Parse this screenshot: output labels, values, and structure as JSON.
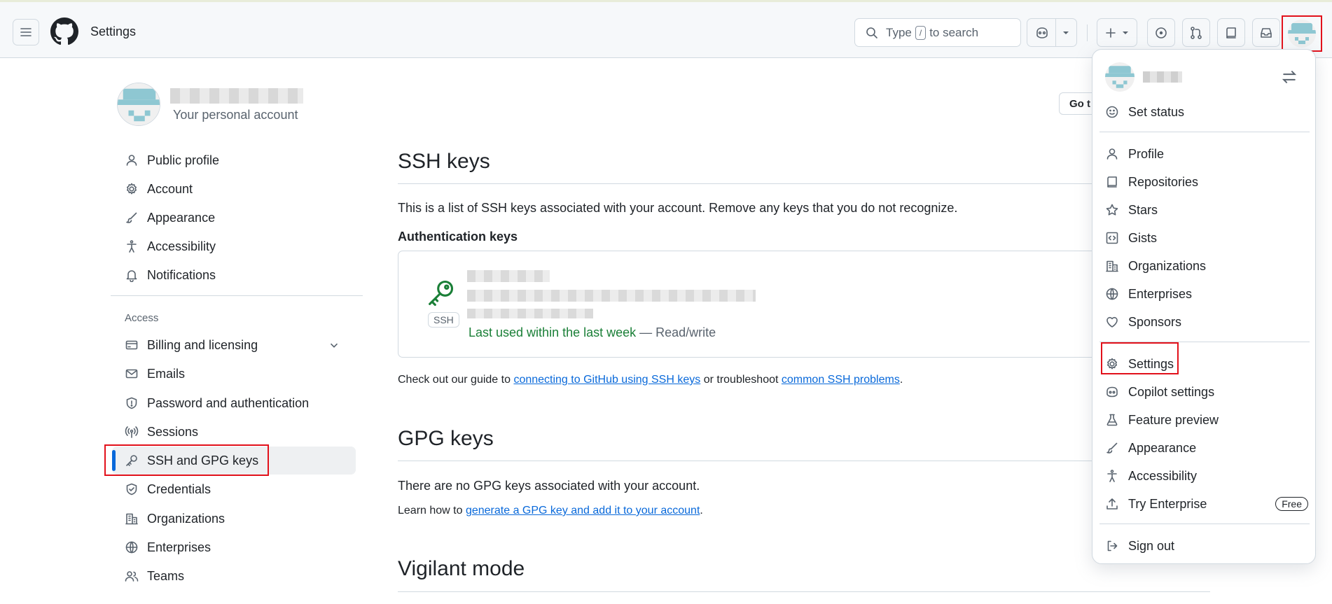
{
  "header": {
    "title": "Settings",
    "search_prefix": "Type",
    "search_key": "/",
    "search_suffix": "to search"
  },
  "profile": {
    "subtitle": "Your personal account"
  },
  "nav": {
    "items_top": [
      {
        "label": "Public profile",
        "icon": "person-icon"
      },
      {
        "label": "Account",
        "icon": "gear-icon"
      },
      {
        "label": "Appearance",
        "icon": "paintbrush-icon"
      },
      {
        "label": "Accessibility",
        "icon": "accessibility-icon"
      },
      {
        "label": "Notifications",
        "icon": "bell-icon"
      }
    ],
    "access_heading": "Access",
    "items_access": [
      {
        "label": "Billing and licensing",
        "icon": "credit-card-icon"
      },
      {
        "label": "Emails",
        "icon": "mail-icon"
      },
      {
        "label": "Password and authentication",
        "icon": "shield-icon"
      },
      {
        "label": "Sessions",
        "icon": "broadcast-icon"
      },
      {
        "label": "SSH and GPG keys",
        "icon": "key-icon"
      },
      {
        "label": "Credentials",
        "icon": "shield-check-icon"
      },
      {
        "label": "Organizations",
        "icon": "organization-icon"
      },
      {
        "label": "Enterprises",
        "icon": "globe-icon"
      },
      {
        "label": "Teams",
        "icon": "people-icon"
      }
    ]
  },
  "main": {
    "go_button": "Go t",
    "ssh_title": "SSH keys",
    "ssh_desc": "This is a list of SSH keys associated with your account. Remove any keys that you do not recognize.",
    "auth_keys_heading": "Authentication keys",
    "key_badge": "SSH",
    "key_last_used": "Last used within the last week",
    "key_access": " — Read/write",
    "guide_prefix": "Check out our guide to ",
    "guide_link1": "connecting to GitHub using SSH keys",
    "guide_middle": " or troubleshoot ",
    "guide_link2": "common SSH problems",
    "guide_suffix": ".",
    "gpg_title": "GPG keys",
    "gpg_desc": "There are no GPG keys associated with your account.",
    "gpg_learn_prefix": "Learn how to ",
    "gpg_learn_link": "generate a GPG key and add it to your account",
    "gpg_learn_suffix": ".",
    "vigilant_title": "Vigilant mode"
  },
  "dropdown": {
    "set_status": "Set status",
    "group1": [
      {
        "label": "Profile",
        "icon": "person-icon"
      },
      {
        "label": "Repositories",
        "icon": "repo-icon"
      },
      {
        "label": "Stars",
        "icon": "star-icon"
      },
      {
        "label": "Gists",
        "icon": "code-square-icon"
      },
      {
        "label": "Organizations",
        "icon": "organization-icon"
      },
      {
        "label": "Enterprises",
        "icon": "globe-icon"
      },
      {
        "label": "Sponsors",
        "icon": "heart-icon"
      }
    ],
    "group2": [
      {
        "label": "Settings",
        "icon": "gear-icon"
      },
      {
        "label": "Copilot settings",
        "icon": "copilot-icon"
      },
      {
        "label": "Feature preview",
        "icon": "beaker-icon"
      },
      {
        "label": "Appearance",
        "icon": "paintbrush-icon"
      },
      {
        "label": "Accessibility",
        "icon": "accessibility-icon"
      },
      {
        "label": "Try Enterprise",
        "icon": "upload-icon"
      }
    ],
    "free_badge": "Free",
    "sign_out": "Sign out"
  },
  "colors": {
    "accent": "#0969da",
    "success": "#1a7f37",
    "highlight": "#e2111b"
  }
}
